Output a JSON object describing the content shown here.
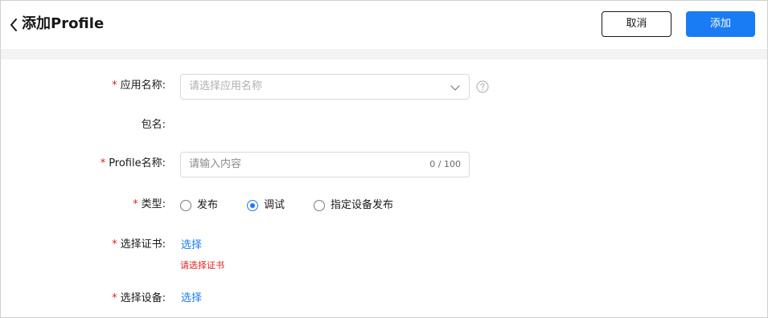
{
  "header": {
    "title": "添加Profile",
    "cancel_label": "取消",
    "add_label": "添加"
  },
  "form": {
    "app_name": {
      "required": "*",
      "label": "应用名称:",
      "placeholder": "请选择应用名称"
    },
    "package_name": {
      "label": "包名:"
    },
    "profile_name": {
      "required": "*",
      "label": "Profile名称:",
      "placeholder": "请输入内容",
      "counter": "0 / 100"
    },
    "type": {
      "required": "*",
      "label": "类型:",
      "options": [
        "发布",
        "调试",
        "指定设备发布"
      ],
      "selected": "调试"
    },
    "certificate": {
      "required": "*",
      "label": "选择证书:",
      "link": "选择",
      "error": "请选择证书"
    },
    "device": {
      "required": "*",
      "label": "选择设备:",
      "link": "选择"
    }
  },
  "colors": {
    "primary": "#1a7cf5",
    "required": "#e02020",
    "divider": "#f3f3f3"
  }
}
